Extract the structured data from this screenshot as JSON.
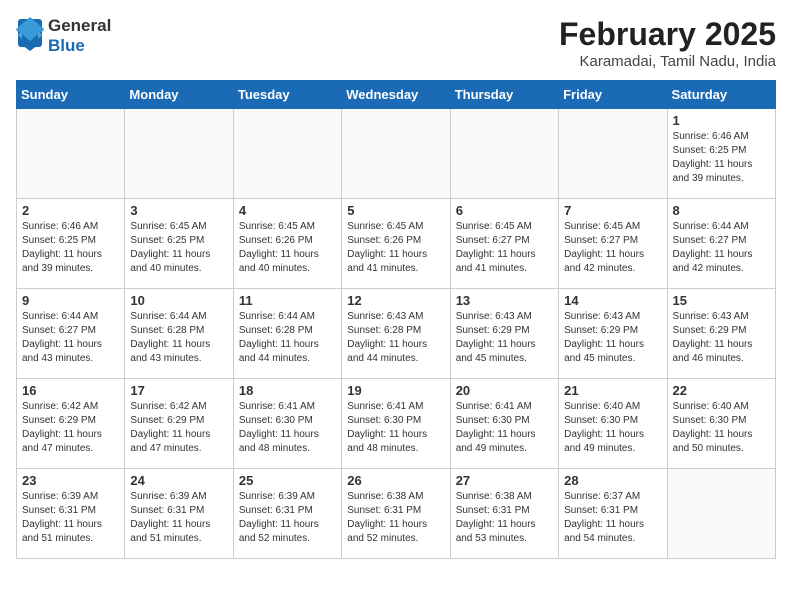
{
  "logo": {
    "general": "General",
    "blue": "Blue"
  },
  "title": "February 2025",
  "subtitle": "Karamadai, Tamil Nadu, India",
  "days_of_week": [
    "Sunday",
    "Monday",
    "Tuesday",
    "Wednesday",
    "Thursday",
    "Friday",
    "Saturday"
  ],
  "weeks": [
    [
      {
        "day": "",
        "info": ""
      },
      {
        "day": "",
        "info": ""
      },
      {
        "day": "",
        "info": ""
      },
      {
        "day": "",
        "info": ""
      },
      {
        "day": "",
        "info": ""
      },
      {
        "day": "",
        "info": ""
      },
      {
        "day": "1",
        "info": "Sunrise: 6:46 AM\nSunset: 6:25 PM\nDaylight: 11 hours and 39 minutes."
      }
    ],
    [
      {
        "day": "2",
        "info": "Sunrise: 6:46 AM\nSunset: 6:25 PM\nDaylight: 11 hours and 39 minutes."
      },
      {
        "day": "3",
        "info": "Sunrise: 6:45 AM\nSunset: 6:25 PM\nDaylight: 11 hours and 40 minutes."
      },
      {
        "day": "4",
        "info": "Sunrise: 6:45 AM\nSunset: 6:26 PM\nDaylight: 11 hours and 40 minutes."
      },
      {
        "day": "5",
        "info": "Sunrise: 6:45 AM\nSunset: 6:26 PM\nDaylight: 11 hours and 41 minutes."
      },
      {
        "day": "6",
        "info": "Sunrise: 6:45 AM\nSunset: 6:27 PM\nDaylight: 11 hours and 41 minutes."
      },
      {
        "day": "7",
        "info": "Sunrise: 6:45 AM\nSunset: 6:27 PM\nDaylight: 11 hours and 42 minutes."
      },
      {
        "day": "8",
        "info": "Sunrise: 6:44 AM\nSunset: 6:27 PM\nDaylight: 11 hours and 42 minutes."
      }
    ],
    [
      {
        "day": "9",
        "info": "Sunrise: 6:44 AM\nSunset: 6:27 PM\nDaylight: 11 hours and 43 minutes."
      },
      {
        "day": "10",
        "info": "Sunrise: 6:44 AM\nSunset: 6:28 PM\nDaylight: 11 hours and 43 minutes."
      },
      {
        "day": "11",
        "info": "Sunrise: 6:44 AM\nSunset: 6:28 PM\nDaylight: 11 hours and 44 minutes."
      },
      {
        "day": "12",
        "info": "Sunrise: 6:43 AM\nSunset: 6:28 PM\nDaylight: 11 hours and 44 minutes."
      },
      {
        "day": "13",
        "info": "Sunrise: 6:43 AM\nSunset: 6:29 PM\nDaylight: 11 hours and 45 minutes."
      },
      {
        "day": "14",
        "info": "Sunrise: 6:43 AM\nSunset: 6:29 PM\nDaylight: 11 hours and 45 minutes."
      },
      {
        "day": "15",
        "info": "Sunrise: 6:43 AM\nSunset: 6:29 PM\nDaylight: 11 hours and 46 minutes."
      }
    ],
    [
      {
        "day": "16",
        "info": "Sunrise: 6:42 AM\nSunset: 6:29 PM\nDaylight: 11 hours and 47 minutes."
      },
      {
        "day": "17",
        "info": "Sunrise: 6:42 AM\nSunset: 6:29 PM\nDaylight: 11 hours and 47 minutes."
      },
      {
        "day": "18",
        "info": "Sunrise: 6:41 AM\nSunset: 6:30 PM\nDaylight: 11 hours and 48 minutes."
      },
      {
        "day": "19",
        "info": "Sunrise: 6:41 AM\nSunset: 6:30 PM\nDaylight: 11 hours and 48 minutes."
      },
      {
        "day": "20",
        "info": "Sunrise: 6:41 AM\nSunset: 6:30 PM\nDaylight: 11 hours and 49 minutes."
      },
      {
        "day": "21",
        "info": "Sunrise: 6:40 AM\nSunset: 6:30 PM\nDaylight: 11 hours and 49 minutes."
      },
      {
        "day": "22",
        "info": "Sunrise: 6:40 AM\nSunset: 6:30 PM\nDaylight: 11 hours and 50 minutes."
      }
    ],
    [
      {
        "day": "23",
        "info": "Sunrise: 6:39 AM\nSunset: 6:31 PM\nDaylight: 11 hours and 51 minutes."
      },
      {
        "day": "24",
        "info": "Sunrise: 6:39 AM\nSunset: 6:31 PM\nDaylight: 11 hours and 51 minutes."
      },
      {
        "day": "25",
        "info": "Sunrise: 6:39 AM\nSunset: 6:31 PM\nDaylight: 11 hours and 52 minutes."
      },
      {
        "day": "26",
        "info": "Sunrise: 6:38 AM\nSunset: 6:31 PM\nDaylight: 11 hours and 52 minutes."
      },
      {
        "day": "27",
        "info": "Sunrise: 6:38 AM\nSunset: 6:31 PM\nDaylight: 11 hours and 53 minutes."
      },
      {
        "day": "28",
        "info": "Sunrise: 6:37 AM\nSunset: 6:31 PM\nDaylight: 11 hours and 54 minutes."
      },
      {
        "day": "",
        "info": ""
      }
    ]
  ]
}
